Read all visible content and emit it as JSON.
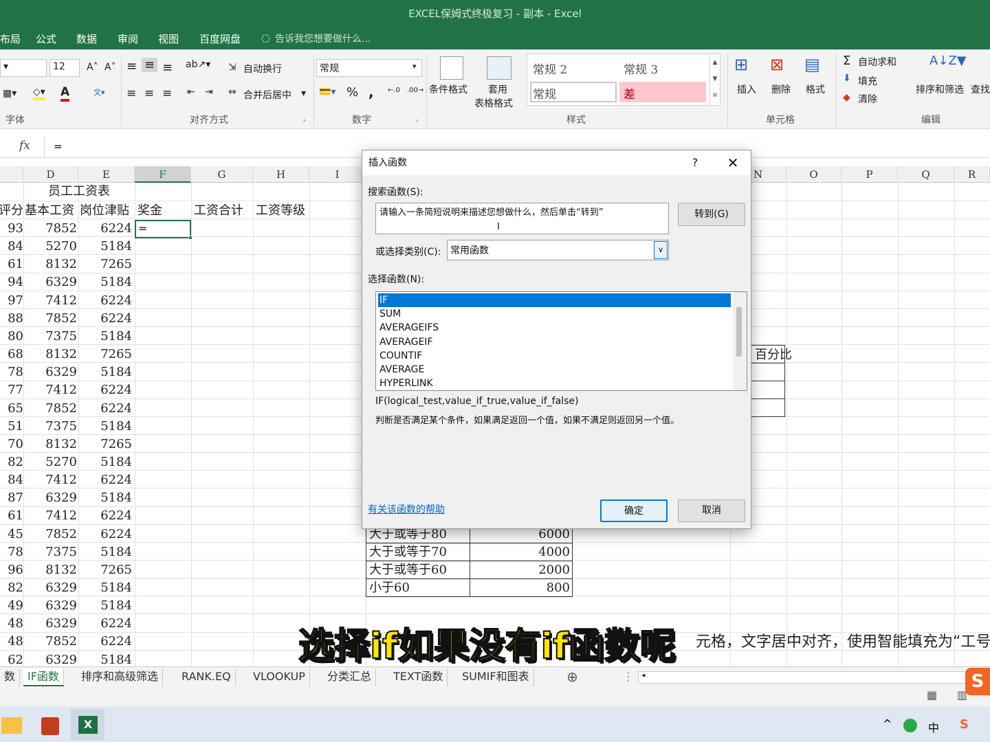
{
  "window": {
    "title": "EXCEL保姆式终极复习 - 副本 - Excel"
  },
  "menu": {
    "items": [
      "布局",
      "公式",
      "数据",
      "审阅",
      "视图",
      "百度网盘"
    ],
    "tell_me": "告诉我您想要做什么..."
  },
  "ribbon": {
    "font_size": "12",
    "wrap_text": "自动换行",
    "merge_center": "合并后居中",
    "number_format": "常规",
    "percent": "%",
    "comma": ",",
    "cond_format": "条件格式",
    "table_format_1": "套用",
    "table_format_2": "表格格式",
    "styles": {
      "normal2": "常规 2",
      "normal3": "常规 3",
      "normal": "常规",
      "bad": "差"
    },
    "insert": "插入",
    "delete": "删除",
    "format": "格式",
    "autosum": "自动求和",
    "fill": "填充",
    "clear": "清除",
    "sort_filter": "排序和筛选",
    "find": "查找",
    "groups": {
      "font": "字体",
      "align": "对齐方式",
      "number": "数字",
      "styles": "样式",
      "cells": "单元格",
      "edit": "编辑"
    }
  },
  "formula": {
    "fx": "fx",
    "value": "="
  },
  "grid": {
    "columns": [
      "D",
      "E",
      "F",
      "G",
      "H",
      "I",
      "N",
      "O",
      "P",
      "Q",
      "R"
    ],
    "title": "员工工资表",
    "headers": [
      "评分",
      "基本工资",
      "岗位津贴",
      "奖金",
      "工资合计",
      "工资等级"
    ],
    "active_cell_value": "=",
    "rows": [
      [
        "93",
        "7852",
        "6224"
      ],
      [
        "84",
        "5270",
        "5184"
      ],
      [
        "61",
        "8132",
        "7265"
      ],
      [
        "94",
        "6329",
        "5184"
      ],
      [
        "97",
        "7412",
        "6224"
      ],
      [
        "88",
        "7852",
        "6224"
      ],
      [
        "80",
        "7375",
        "5184"
      ],
      [
        "68",
        "8132",
        "7265"
      ],
      [
        "78",
        "6329",
        "5184"
      ],
      [
        "77",
        "7412",
        "6224"
      ],
      [
        "65",
        "7852",
        "6224"
      ],
      [
        "51",
        "7375",
        "5184"
      ],
      [
        "70",
        "8132",
        "7265"
      ],
      [
        "82",
        "5270",
        "5184"
      ],
      [
        "84",
        "7412",
        "6224"
      ],
      [
        "87",
        "6329",
        "5184"
      ],
      [
        "61",
        "7412",
        "6224"
      ],
      [
        "45",
        "7852",
        "6224"
      ],
      [
        "78",
        "7375",
        "5184"
      ],
      [
        "96",
        "8132",
        "7265"
      ],
      [
        "82",
        "6329",
        "5184"
      ],
      [
        "49",
        "6329",
        "5184"
      ],
      [
        "48",
        "6329",
        "6224"
      ],
      [
        "48",
        "7852",
        "6224"
      ],
      [
        "62",
        "6329",
        "5184"
      ]
    ],
    "percent_label": "百分比",
    "bonus_table": [
      [
        "大于或等于80",
        "6000"
      ],
      [
        "大于或等于70",
        "4000"
      ],
      [
        "大于或等于60",
        "2000"
      ],
      [
        "小于60",
        "800"
      ]
    ],
    "note": "元格，文字居中对齐，使用智能填充为“工号"
  },
  "sheets": [
    "数",
    "IF函数",
    "排序和高级筛选",
    "RANK.EQ",
    "VLOOKUP",
    "分类汇总",
    "TEXT函数",
    "SUMIF和图表"
  ],
  "active_sheet": "IF函数",
  "subtitle": "选择if如果没有if函数呢",
  "dialog": {
    "title": "插入函数",
    "help": "?",
    "close": "✕",
    "search_label": "搜索函数(S):",
    "search_value": "请输入一条简短说明来描述您想做什么，然后单击“转到”",
    "go_button": "转到(G)",
    "category_label": "或选择类别(C):",
    "category_value": "常用函数",
    "select_label": "选择函数(N):",
    "functions": [
      "IF",
      "SUM",
      "AVERAGEIFS",
      "AVERAGEIF",
      "COUNTIF",
      "AVERAGE",
      "HYPERLINK"
    ],
    "selected": "IF",
    "signature": "IF(logical_test,value_if_true,value_if_false)",
    "description": "判断是否满足某个条件，如果满足返回一个值，如果不满足则返回另一个值。",
    "help_link": "有关该函数的帮助",
    "ok": "确定",
    "cancel": "取消"
  },
  "taskbar": {
    "ime": "中"
  },
  "colors": {
    "excel_green": "#217346",
    "select_blue": "#0078d7",
    "bad_style_bg": "#ffc7ce",
    "subtitle": "#ffe600"
  }
}
